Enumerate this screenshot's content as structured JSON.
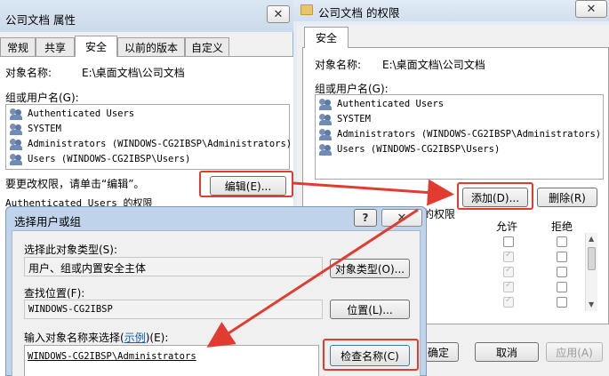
{
  "props_window": {
    "title": "公司文档 属性",
    "tabs": [
      "常规",
      "共享",
      "安全",
      "以前的版本",
      "自定义"
    ],
    "object_label": "对象名称:",
    "object_value": "E:\\桌面文档\\公司文档",
    "groups_label": "组或用户名(G):",
    "users": [
      "Authenticated Users",
      "SYSTEM",
      "Administrators (WINDOWS-CG2IBSP\\Administrators)",
      "Users (WINDOWS-CG2IBSP\\Users)"
    ],
    "change_hint": "要更改权限，请单击“编辑”。",
    "edit_button": "编辑(E)...",
    "perm_label": "Authenticated Users 的权限"
  },
  "perm_window": {
    "title": "公司文档 的权限",
    "tab": "安全",
    "object_label": "对象名称:",
    "object_value": "E:\\桌面文档\\公司文档",
    "groups_label": "组或用户名(G):",
    "users": [
      "Authenticated Users",
      "SYSTEM",
      "Administrators (WINDOWS-CG2IBSP\\Administrators)",
      "Users (WINDOWS-CG2IBSP\\Users)"
    ],
    "add_button": "添加(D)...",
    "remove_button": "删除(R)",
    "perm_partial": "的权限",
    "allow_header": "允许",
    "deny_header": "拒绝",
    "ok_partial": "确定",
    "cancel_button": "取消",
    "apply_button": "应用(A)"
  },
  "select_dialog": {
    "title": "选择用户或组",
    "type_label": "选择此对象类型(S):",
    "type_value": "用户、组或内置安全主体",
    "type_button": "对象类型(O)...",
    "location_label": "查找位置(F):",
    "location_value": "WINDOWS-CG2IBSP",
    "location_button": "位置(L)...",
    "names_label_prefix": "输入对象名称来选择(",
    "names_label_link": "示例",
    "names_label_suffix": ")(E):",
    "names_value": "WINDOWS-CG2IBSP\\Administrators",
    "check_button": "检查名称(C)"
  },
  "annotation": {
    "color": "#e23c30"
  }
}
